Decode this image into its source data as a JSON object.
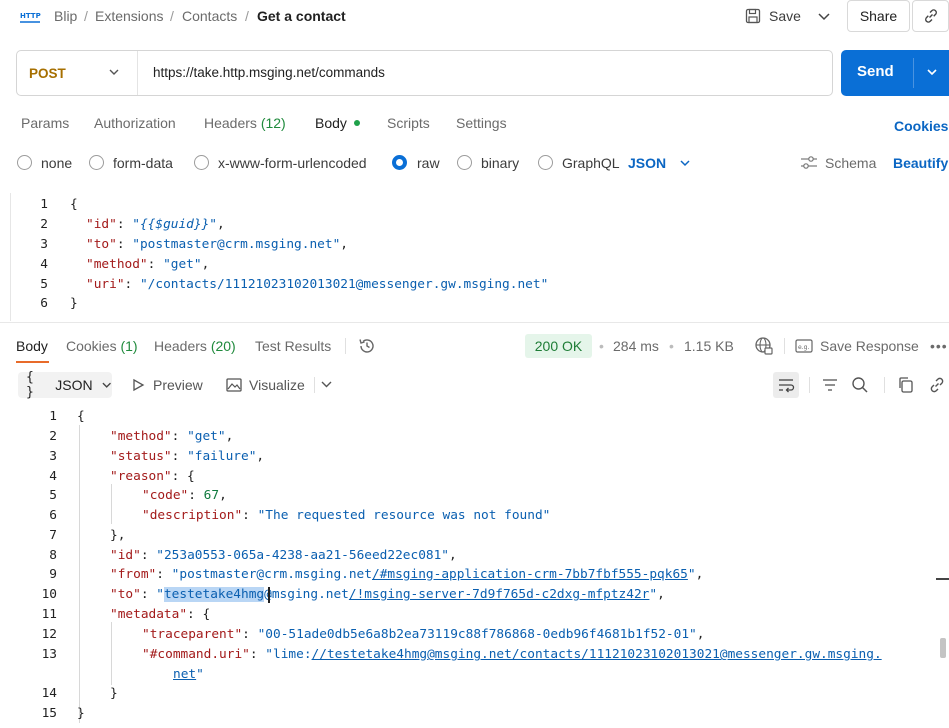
{
  "breadcrumb": {
    "items": [
      "Blip",
      "Extensions",
      "Contacts"
    ],
    "current": "Get a contact"
  },
  "header": {
    "save_label": "Save",
    "share_label": "Share"
  },
  "request": {
    "method": "POST",
    "url": "https://take.http.msging.net/commands",
    "send_label": "Send"
  },
  "request_tabs": {
    "params": "Params",
    "authorization": "Authorization",
    "headers": "Headers",
    "headers_count": "(12)",
    "body": "Body",
    "scripts": "Scripts",
    "settings": "Settings",
    "cookies": "Cookies"
  },
  "body_types": {
    "none": "none",
    "form_data": "form-data",
    "urlencoded": "x-www-form-urlencoded",
    "raw": "raw",
    "binary": "binary",
    "graphql": "GraphQL",
    "format": "JSON",
    "schema": "Schema",
    "beautify": "Beautify"
  },
  "request_body": {
    "line_numbers": [
      "1",
      "2",
      "3",
      "4",
      "5",
      "6"
    ],
    "open_brace": "{",
    "close_brace": "}",
    "id_key": "\"id\"",
    "id_value": "\"{{$guid}}\"",
    "to_key": "\"to\"",
    "to_value": "\"postmaster@crm.msging.net\"",
    "method_key": "\"method\"",
    "method_value": "\"get\"",
    "uri_key": "\"uri\"",
    "uri_value": "\"/contacts/11121023102013021@messenger.gw.msging.net\""
  },
  "response_tabs": {
    "body": "Body",
    "cookies": "Cookies",
    "cookies_count": "(1)",
    "headers": "Headers",
    "headers_count": "(20)",
    "test_results": "Test Results",
    "status": "200 OK",
    "time": "284 ms",
    "size": "1.15 KB",
    "save_response": "Save Response"
  },
  "response_toolbar": {
    "format": "JSON",
    "preview": "Preview",
    "visualize": "Visualize"
  },
  "response_body": {
    "line_numbers": [
      "1",
      "2",
      "3",
      "4",
      "5",
      "6",
      "7",
      "8",
      "9",
      "10",
      "11",
      "12",
      "13",
      "14",
      "15"
    ],
    "l1": "{",
    "method_key": "\"method\"",
    "method_value": "\"get\"",
    "status_key": "\"status\"",
    "status_value": "\"failure\"",
    "reason_key": "\"reason\"",
    "code_key": "\"code\"",
    "code_value": "67",
    "description_key": "\"description\"",
    "description_value": "\"The requested resource was not found\"",
    "l7": "},",
    "id_key": "\"id\"",
    "id_value": "\"253a0553-065a-4238-aa21-56eed22ec081\"",
    "from_key": "\"from\"",
    "from_value_a": "\"postmaster@crm.msging.net",
    "from_value_b": "/#msging-application-crm-7bb7fbf555-pqk65",
    "from_value_c": "\"",
    "to_key": "\"to\"",
    "to_value_q": "\"",
    "to_value_sel": "testetake4hmg",
    "to_value_a": "@msging.net",
    "to_value_b": "/!msging-server-7d9f765d-c2dxg-mfptz42r",
    "to_value_c": "\"",
    "metadata_key": "\"metadata\"",
    "traceparent_key": "\"traceparent\"",
    "traceparent_value": "\"00-51ade0db5e6a8b2ea73119c88f786868-0edb96f4681b1f52-01\"",
    "command_uri_key": "\"#command.uri\"",
    "command_uri_a": "\"lime:",
    "command_uri_b": "//testetake4hmg@msging.net/contacts/11121023102013021@messenger.gw.msging.",
    "command_uri_c": "net",
    "command_uri_d": "\"",
    "l14": "}",
    "l15": "}"
  }
}
